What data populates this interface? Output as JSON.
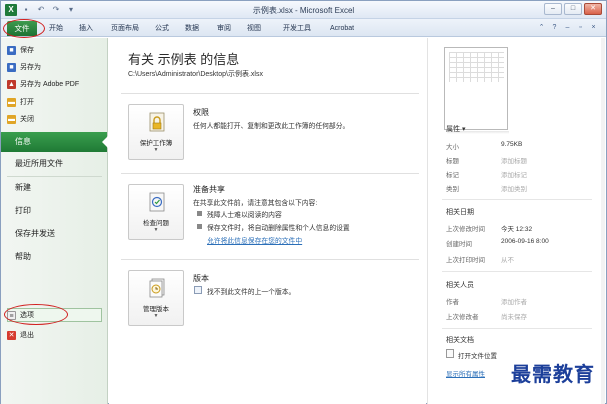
{
  "window": {
    "title": "示例表.xlsx - Microsoft Excel",
    "app_icon": "X"
  },
  "ribbon": {
    "tabs": [
      "文件",
      "开始",
      "插入",
      "页面布局",
      "公式",
      "数据",
      "审阅",
      "视图",
      "开发工具",
      "Acrobat"
    ]
  },
  "nav": {
    "commands": [
      {
        "label": "保存",
        "icon": "save-icon",
        "color": "#3a6cc2"
      },
      {
        "label": "另存为",
        "icon": "save-as-icon",
        "color": "#3a6cc2"
      },
      {
        "label": "另存为 Adobe PDF",
        "icon": "pdf-icon",
        "color": "#c0392b"
      },
      {
        "label": "打开",
        "icon": "open-folder-icon",
        "color": "#e0a526"
      },
      {
        "label": "关闭",
        "icon": "close-file-icon",
        "color": "#e0a526"
      }
    ],
    "items": [
      "信息",
      "最近所用文件",
      "新建",
      "打印",
      "保存并发送",
      "帮助"
    ],
    "options": "选项",
    "exit": "退出"
  },
  "main": {
    "title": "有关 示例表 的信息",
    "path": "C:\\Users\\Administrator\\Desktop\\示例表.xlsx",
    "sections": [
      {
        "button": "保护工作簿",
        "heading": "权限",
        "text": "任何人都能打开、复制和更改此工作簿的任何部分。"
      },
      {
        "button": "检查问题",
        "heading": "准备共享",
        "text": "在共享此文件前，请注意其包含以下内容:",
        "bullets": [
          "残障人士难以阅读的内容",
          "保存文件时，将自动删除属性和个人信息的设置"
        ],
        "link": "允许将此信息保存在您的文件中"
      },
      {
        "button": "管理版本",
        "heading": "版本",
        "text": "找不到此文件的上一个版本。"
      }
    ]
  },
  "props": {
    "header": "属性 ▾",
    "rows": [
      {
        "key": "大小",
        "value": "9.75KB",
        "muted": false
      },
      {
        "key": "标题",
        "value": "添加标题",
        "muted": true
      },
      {
        "key": "标记",
        "value": "添加标记",
        "muted": true
      },
      {
        "key": "类别",
        "value": "添加类别",
        "muted": true
      }
    ],
    "dates_header": "相关日期",
    "dates": [
      {
        "key": "上次修改时间",
        "value": "今天 12:32",
        "muted": false
      },
      {
        "key": "创建时间",
        "value": "2006-09-16 8:00",
        "muted": false
      },
      {
        "key": "上次打印时间",
        "value": "从不",
        "muted": true
      }
    ],
    "people_header": "相关人员",
    "people": [
      {
        "key": "作者",
        "value": "添加作者",
        "muted": true
      },
      {
        "key": "上次修改者",
        "value": "尚未保存",
        "muted": true
      }
    ],
    "docs_header": "相关文档",
    "open_location": "打开文件位置",
    "show_all": "显示所有属性"
  },
  "watermark": "最需教育"
}
